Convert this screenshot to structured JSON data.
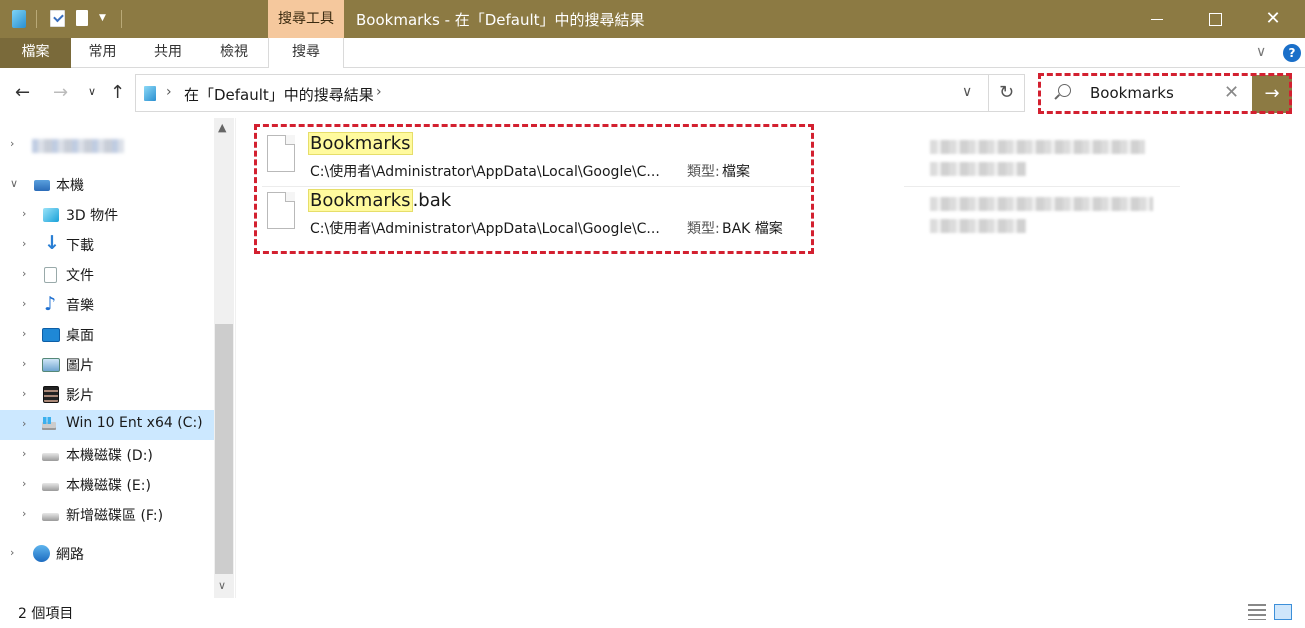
{
  "titlebar": {
    "context_tab": "搜尋工具",
    "title": "Bookmarks - 在「Default」中的搜尋結果"
  },
  "ribbon": {
    "tabs": [
      "檔案",
      "常用",
      "共用",
      "檢視",
      "搜尋"
    ]
  },
  "address": {
    "path": "在「Default」中的搜尋結果"
  },
  "search": {
    "query": "Bookmarks"
  },
  "sidebar": {
    "this_pc": "本機",
    "items": [
      "3D 物件",
      "下載",
      "文件",
      "音樂",
      "桌面",
      "圖片",
      "影片",
      "Win 10 Ent x64 (C:)",
      "本機磁碟 (D:)",
      "本機磁碟 (E:)",
      "新增磁碟區 (F:)"
    ],
    "network": "網路"
  },
  "results": [
    {
      "name_highlight": "Bookmarks",
      "name_rest": "",
      "path": "C:\\使用者\\Administrator\\AppData\\Local\\Google\\C...",
      "type_label": "類型:",
      "type_value": "檔案"
    },
    {
      "name_highlight": "Bookmarks",
      "name_rest": ".bak",
      "path": "C:\\使用者\\Administrator\\AppData\\Local\\Google\\C...",
      "type_label": "類型:",
      "type_value": "BAK 檔案"
    }
  ],
  "status": {
    "item_count": "2 個項目"
  },
  "colors": {
    "titlebar": "#8c7a43",
    "context_tab": "#f5c89d",
    "highlight": "#fffa9e",
    "annotation": "#d32030",
    "selection": "#cce8ff"
  }
}
